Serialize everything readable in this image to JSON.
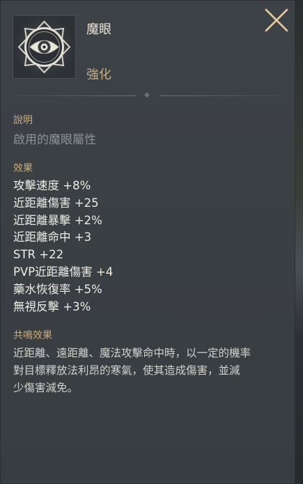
{
  "item": {
    "name": "魔眼",
    "grade": "強化",
    "icon": "magic-eye-icon"
  },
  "close_icon": "close-x-icon",
  "description": {
    "title": "說明",
    "text": "啟用的魔眼屬性"
  },
  "effects": {
    "title": "效果",
    "list": [
      "攻擊速度 +8%",
      "近距離傷害 +25",
      "近距離暴擊 +2%",
      "近距離命中 +3",
      "STR +22",
      "PVP近距離傷害 +4",
      "藥水恢復率 +5%",
      "無視反擊 +3%"
    ]
  },
  "resonance": {
    "title": "共鳴效果",
    "lines": [
      "近距離、遠距離、魔法攻擊命中時，以一定的機率",
      "對目標釋放法利昂的寒氣，使其造成傷害，並減",
      "少傷害減免。"
    ]
  },
  "colors": {
    "panel_bg": "#3b4045",
    "section_title": "#c9ab7e",
    "stat_text": "#eeece6",
    "muted_text": "#8d9196"
  }
}
